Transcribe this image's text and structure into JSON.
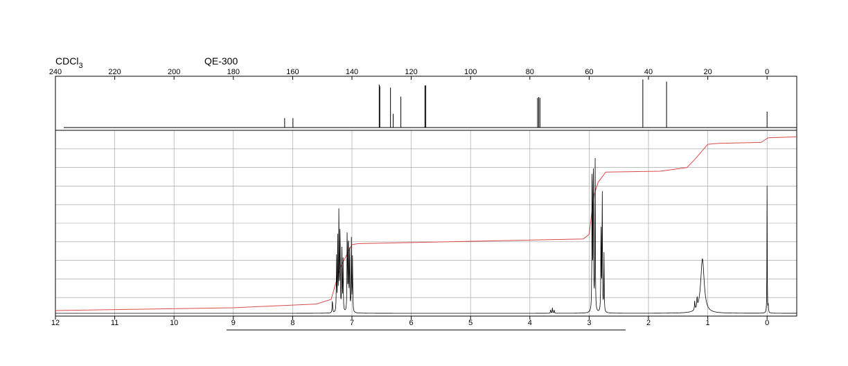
{
  "chart_data": [
    {
      "type": "line",
      "solvent": "CDCl",
      "solvent_subscript": "3",
      "instrument": "QE-300",
      "xlim": [
        240,
        -10
      ],
      "ticks": [
        240,
        220,
        200,
        180,
        160,
        140,
        120,
        100,
        80,
        60,
        40,
        20,
        0
      ],
      "ylim": [
        0,
        1
      ],
      "peaks": [
        {
          "x": 162.7,
          "h": 0.22
        },
        {
          "x": 159.9,
          "h": 0.22
        },
        {
          "x": 130.8,
          "h": 1.0
        },
        {
          "x": 130.6,
          "h": 0.96
        },
        {
          "x": 127.0,
          "h": 0.93
        },
        {
          "x": 126.1,
          "h": 0.32
        },
        {
          "x": 123.5,
          "h": 0.72
        },
        {
          "x": 115.4,
          "h": 0.98
        },
        {
          "x": 115.1,
          "h": 0.98
        },
        {
          "x": 77.4,
          "h": 0.69
        },
        {
          "x": 77.0,
          "h": 0.71
        },
        {
          "x": 76.6,
          "h": 0.69
        },
        {
          "x": 41.9,
          "h": 1.12
        },
        {
          "x": 33.9,
          "h": 1.07
        },
        {
          "x": 0.0,
          "h": 0.37
        }
      ]
    },
    {
      "type": "line",
      "xlim": [
        12,
        -0.5
      ],
      "ticks": [
        12,
        11,
        10,
        9,
        8,
        7,
        6,
        5,
        4,
        3,
        2,
        1,
        0
      ],
      "ylim": [
        0,
        1
      ],
      "grid": true,
      "peaks": [
        {
          "x": 7.33,
          "h": 0.07,
          "w": 0.005
        },
        {
          "x": 7.26,
          "h": 0.3,
          "w": 0.004
        },
        {
          "x": 7.24,
          "h": 0.4,
          "w": 0.004
        },
        {
          "x": 7.22,
          "h": 0.58,
          "w": 0.004
        },
        {
          "x": 7.2,
          "h": 0.52,
          "w": 0.004
        },
        {
          "x": 7.17,
          "h": 0.4,
          "w": 0.004
        },
        {
          "x": 7.15,
          "h": 0.3,
          "w": 0.004
        },
        {
          "x": 7.08,
          "h": 0.5,
          "w": 0.004
        },
        {
          "x": 7.06,
          "h": 0.48,
          "w": 0.004
        },
        {
          "x": 7.04,
          "h": 0.38,
          "w": 0.004
        },
        {
          "x": 7.01,
          "h": 0.4,
          "w": 0.004
        },
        {
          "x": 6.99,
          "h": 0.3,
          "w": 0.004
        },
        {
          "x": 3.65,
          "h": 0.02,
          "w": 0.004
        },
        {
          "x": 3.62,
          "h": 0.03,
          "w": 0.004
        },
        {
          "x": 3.59,
          "h": 0.02,
          "w": 0.004
        },
        {
          "x": 2.95,
          "h": 0.9,
          "w": 0.004
        },
        {
          "x": 2.93,
          "h": 0.96,
          "w": 0.004
        },
        {
          "x": 2.9,
          "h": 0.88,
          "w": 0.004
        },
        {
          "x": 2.8,
          "h": 0.54,
          "w": 0.004
        },
        {
          "x": 2.78,
          "h": 0.7,
          "w": 0.004
        },
        {
          "x": 2.75,
          "h": 0.32,
          "w": 0.004
        },
        {
          "x": 1.22,
          "h": 0.05,
          "w": 0.005
        },
        {
          "x": 1.18,
          "h": 0.06,
          "w": 0.005
        },
        {
          "x": 1.09,
          "h": 0.3,
          "w": 0.035
        },
        {
          "x": 0.0,
          "h": 0.7,
          "w": 0.003
        },
        {
          "x": -0.02,
          "h": 0.04,
          "w": 0.004
        }
      ],
      "integral": [
        [
          12.0,
          0.03
        ],
        [
          9.0,
          0.045
        ],
        [
          7.6,
          0.065
        ],
        [
          7.35,
          0.09
        ],
        [
          7.2,
          0.26
        ],
        [
          7.0,
          0.385
        ],
        [
          6.9,
          0.39
        ],
        [
          3.1,
          0.415
        ],
        [
          3.0,
          0.44
        ],
        [
          2.92,
          0.65
        ],
        [
          2.85,
          0.72
        ],
        [
          2.72,
          0.775
        ],
        [
          1.8,
          0.78
        ],
        [
          1.35,
          0.8
        ],
        [
          1.2,
          0.85
        ],
        [
          1.0,
          0.925
        ],
        [
          0.8,
          0.93
        ],
        [
          0.1,
          0.935
        ],
        [
          -0.02,
          0.96
        ],
        [
          -0.5,
          0.965
        ]
      ],
      "integral_color": "#d94a4a"
    }
  ]
}
